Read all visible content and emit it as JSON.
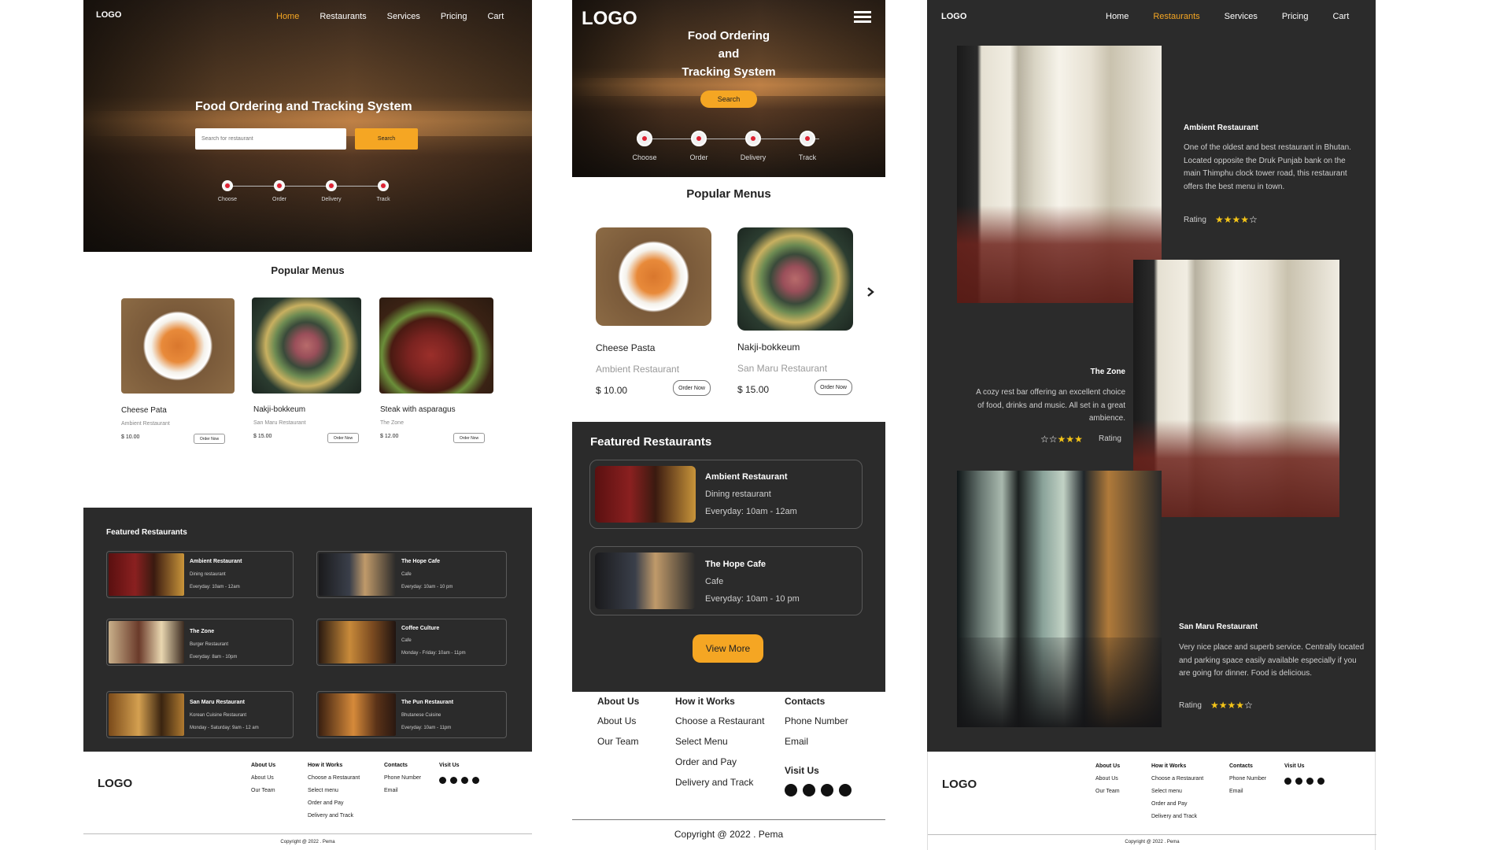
{
  "desktop": {
    "logo": "LOGO",
    "nav": [
      "Home",
      "Restaurants",
      "Services",
      "Pricing",
      "Cart"
    ],
    "hero_title": "Food Ordering and Tracking System",
    "search_placeholder": "Search for restaurant",
    "search_button": "Search",
    "steps": [
      "Choose",
      "Order",
      "Delivery",
      "Track"
    ],
    "popular_title": "Popular Menus",
    "menus": [
      {
        "name": "Cheese Pata",
        "restaurant": "Ambient Restaurant",
        "price": "$ 10.00",
        "order": "Order Now"
      },
      {
        "name": "Nakji-bokkeum",
        "restaurant": "San Maru Restaurant",
        "price": "$ 15.00",
        "order": "Order Now"
      },
      {
        "name": "Steak with asparagus",
        "restaurant": "The Zone",
        "price": "$ 12.00",
        "order": "Order Now"
      }
    ],
    "featured_title": "Featured Restaurants",
    "featured": [
      {
        "name": "Ambient Restaurant",
        "type": "Dining restaurant",
        "hours": "Everyday: 10am - 12am"
      },
      {
        "name": "The Hope Cafe",
        "type": "Cafe",
        "hours": "Everyday: 10am - 10 pm"
      },
      {
        "name": "The Zone",
        "type": "Burger Restaurant",
        "hours": "Everyday: 8am - 10pm"
      },
      {
        "name": "Coffee Culture",
        "type": "Cafe",
        "hours": "Monday - Friday: 10am - 11pm"
      },
      {
        "name": "San Maru Restaurant",
        "type": "Korean Cuisine Restaurant",
        "hours": "Monday - Saturday: 9am - 12 am"
      },
      {
        "name": "The Pun Restaurant",
        "type": "Bhutanese Cuisine",
        "hours": "Everyday: 10am - 11pm"
      }
    ],
    "footer": {
      "logo": "LOGO",
      "about_head": "About Us",
      "about": [
        "About Us",
        "Our Team"
      ],
      "how_head": "How it Works",
      "how": [
        "Choose a Restaurant",
        "Select menu",
        "Order and Pay",
        "Delivery and Track"
      ],
      "contacts_head": "Contacts",
      "contacts": [
        "Phone Number",
        "Email"
      ],
      "visit_head": "Visit Us",
      "social_icons": [
        "youtube-icon",
        "twitter-icon",
        "facebook-icon",
        "instagram-icon"
      ],
      "copyright": "Copyright @ 2022 . Pema"
    }
  },
  "mobile": {
    "logo": "LOGO",
    "hero_title": [
      "Food Ordering",
      "and",
      "Tracking System"
    ],
    "search_button": "Search",
    "steps": [
      "Choose",
      "Order",
      "Delivery",
      "Track"
    ],
    "popular_title": "Popular Menus",
    "menus": [
      {
        "name": "Cheese Pasta",
        "restaurant": "Ambient Restaurant",
        "price": "$ 10.00",
        "order": "Order Now"
      },
      {
        "name": "Nakji-bokkeum",
        "restaurant": "San Maru Restaurant",
        "price": "$ 15.00",
        "order": "Order Now"
      }
    ],
    "featured_title": "Featured Restaurants",
    "featured": [
      {
        "name": "Ambient Restaurant",
        "type": "Dining restaurant",
        "hours": "Everyday: 10am - 12am"
      },
      {
        "name": "The Hope Cafe",
        "type": "Cafe",
        "hours": "Everyday: 10am - 10 pm"
      }
    ],
    "view_more": "View More",
    "footer": {
      "about_head": "About Us",
      "about": [
        "About Us",
        "Our Team"
      ],
      "how_head": "How it Works",
      "how": [
        "Choose a Restaurant",
        "Select Menu",
        "Order and Pay",
        "Delivery and Track"
      ],
      "contacts_head": "Contacts",
      "contacts": [
        "Phone Number",
        "Email"
      ],
      "visit_head": "Visit Us",
      "copyright": "Copyright @ 2022 . Pema"
    }
  },
  "restaurants_page": {
    "logo": "LOGO",
    "nav": [
      "Home",
      "Restaurants",
      "Services",
      "Pricing",
      "Cart"
    ],
    "items": [
      {
        "name": "Ambient Restaurant",
        "desc": "One of the oldest and best restaurant in Bhutan. Located opposite the Druk Punjab bank on the main Thimphu clock tower road, this restaurant offers the best menu in town.",
        "rating_label": "Rating",
        "rating": 4
      },
      {
        "name": "The Zone",
        "desc": "A cozy rest bar offering an excellent choice of food, drinks and music. All set in a great ambience.",
        "rating_label": "Rating",
        "rating": 3
      },
      {
        "name": "San Maru Restaurant",
        "desc": "Very nice place and superb service. Centrally located and parking space easily available especially if you are going for dinner. Food is delicious.",
        "rating_label": "Rating",
        "rating": 4
      }
    ],
    "footer": {
      "logo": "LOGO",
      "about_head": "About Us",
      "about": [
        "About Us",
        "Our Team"
      ],
      "how_head": "How it Works",
      "how": [
        "Choose a Restaurant",
        "Select menu",
        "Order and Pay",
        "Delivery and Track"
      ],
      "contacts_head": "Contacts",
      "contacts": [
        "Phone Number",
        "Email"
      ],
      "visit_head": "Visit Us",
      "copyright": "Copyright @ 2022 . Pema"
    }
  },
  "colors": {
    "accent": "#f5a623",
    "dark_panel": "#2b2b2b",
    "star": "#f5c518"
  }
}
